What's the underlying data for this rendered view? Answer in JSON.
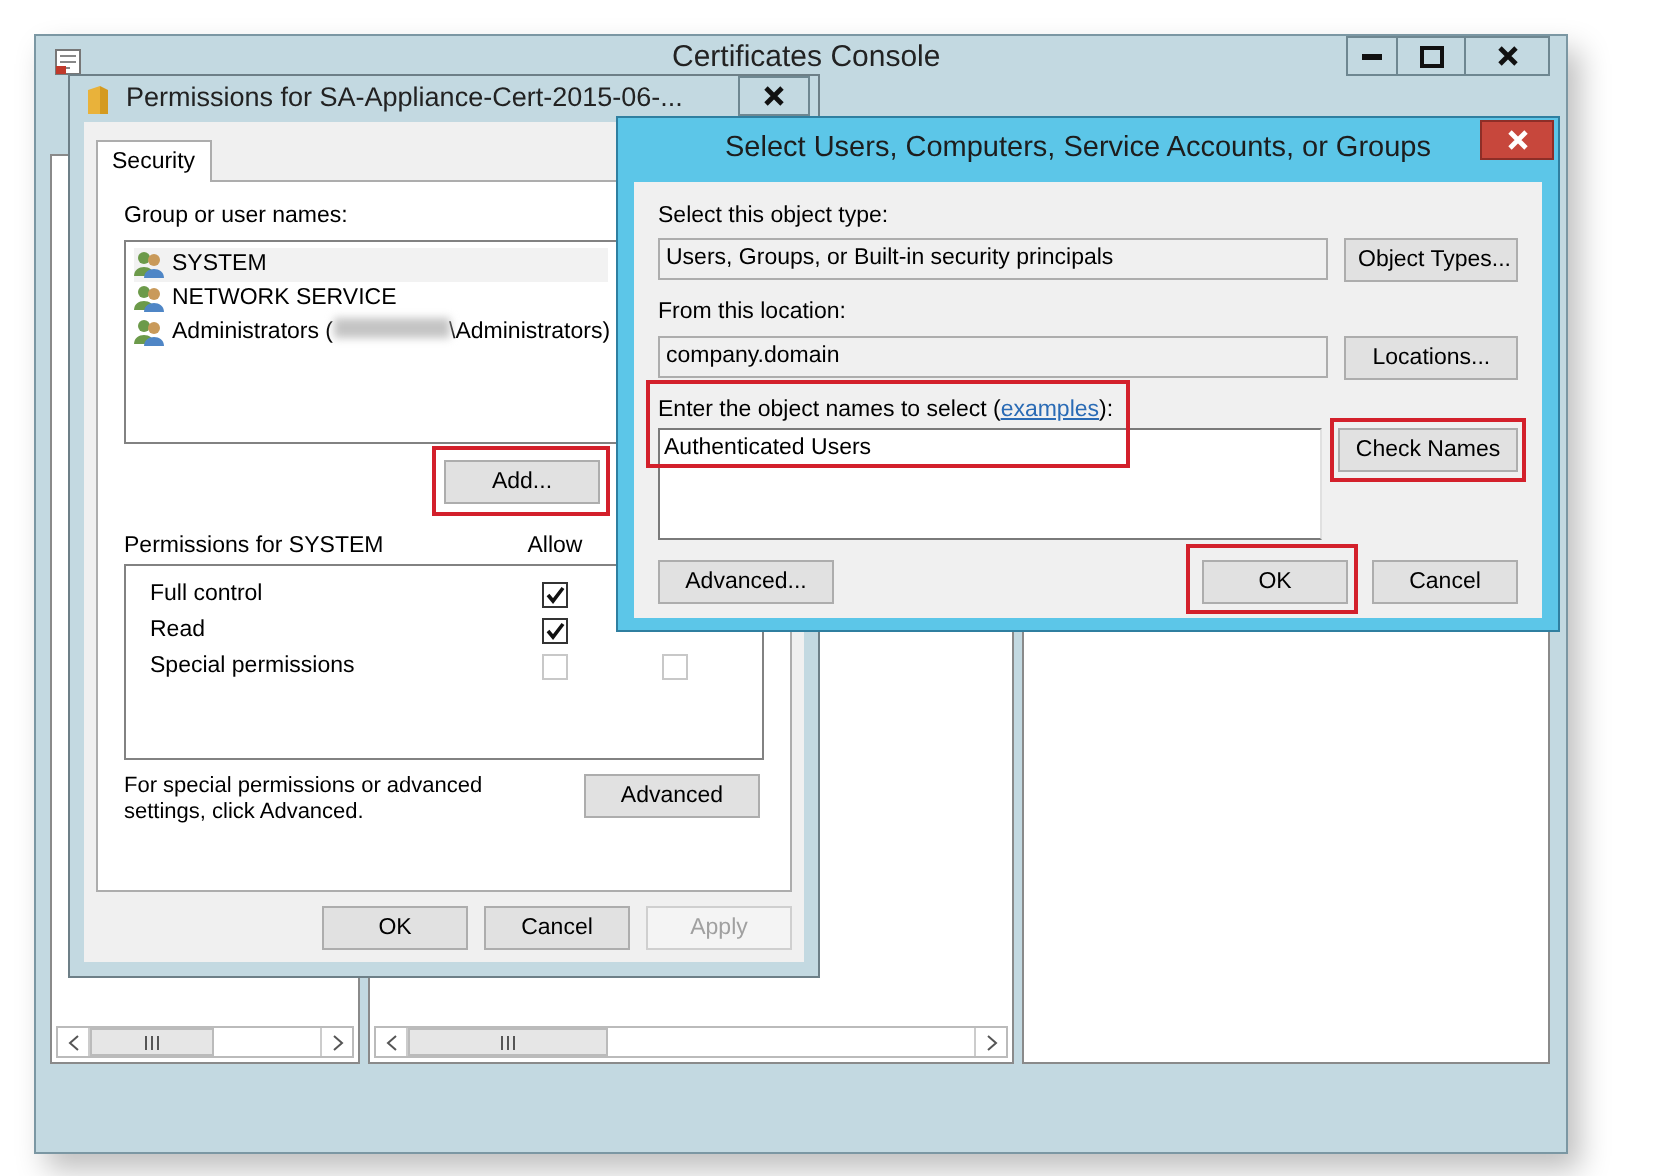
{
  "console": {
    "title": "Certificates Console"
  },
  "permissions_dialog": {
    "title": "Permissions for SA-Appliance-Cert-2015-06-...",
    "tabs": [
      {
        "label": "Security",
        "selected": true
      }
    ],
    "group_label": "Group or user names:",
    "users": [
      {
        "name": "SYSTEM",
        "selected": true
      },
      {
        "name": "NETWORK SERVICE",
        "selected": false
      },
      {
        "name": "Administrators (",
        "redacted": true,
        "suffix": "\\Administrators)",
        "selected": false
      }
    ],
    "add_button": {
      "label": "Add...",
      "highlighted": true
    },
    "permissions_label": "Permissions for SYSTEM",
    "allow_header": "Allow",
    "permissions": [
      {
        "name": "Full control",
        "allow": true,
        "disabled": false
      },
      {
        "name": "Read",
        "allow": true,
        "disabled": false
      },
      {
        "name": "Special permissions",
        "allow": false,
        "deny": false,
        "disabled": true
      }
    ],
    "advanced_note": "For special permissions or advanced settings, click Advanced.",
    "advanced_button": "Advanced",
    "buttons": [
      {
        "label": "OK",
        "disabled": false
      },
      {
        "label": "Cancel",
        "disabled": false
      },
      {
        "label": "Apply",
        "disabled": true
      }
    ]
  },
  "select_dialog": {
    "title": "Select Users, Computers, Service Accounts, or Groups",
    "object_type_label": "Select this object type:",
    "object_type": "Users, Groups, or Built-in security principals",
    "object_types_button": "Object Types...",
    "location_label": "From this location:",
    "location": "company.domain",
    "locations_button": "Locations...",
    "names_label": "Enter the object names to select (",
    "examples_link": "examples",
    "names_label_end": "):",
    "names_label_highlighted": true,
    "names_value": "Authenticated Users",
    "check_names_button": {
      "label": "Check Names",
      "highlighted": true
    },
    "advanced_button": {
      "label": "Advanced..."
    },
    "ok_button": {
      "label": "OK",
      "highlighted": true
    },
    "cancel_button": {
      "label": "Cancel"
    }
  }
}
